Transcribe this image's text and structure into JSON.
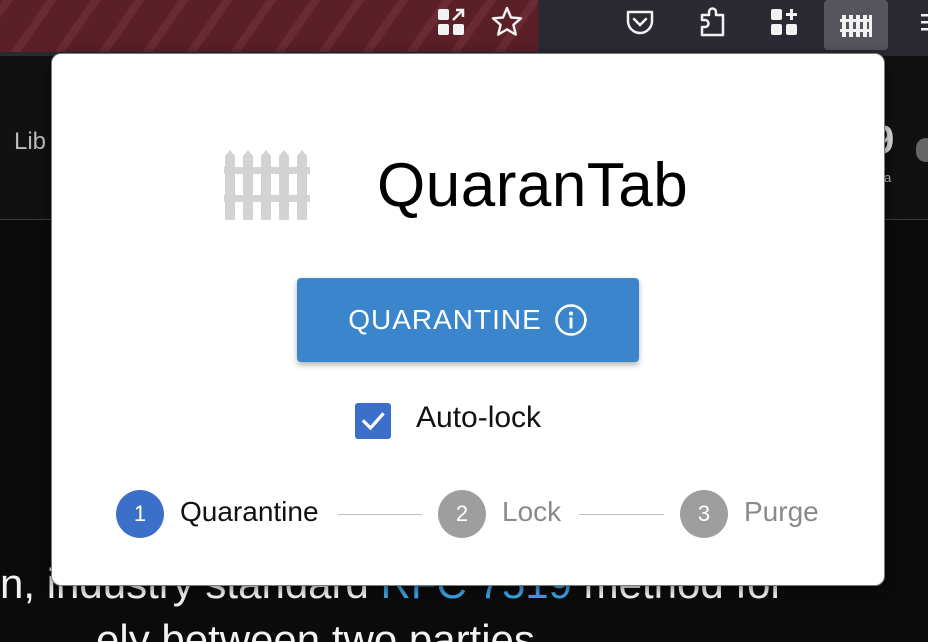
{
  "page": {
    "left_text": "Lib",
    "right_glyph": "9",
    "right_small": "a",
    "bottom_text_before": "n, industry standard ",
    "bottom_link": "RFC 7519",
    "bottom_text_after": " method for",
    "bottom_text2": "ely between two parties."
  },
  "toolbar": {
    "icons": [
      "extensions-grid-icon",
      "bookmark-star-icon",
      "pocket-icon",
      "extensions-puzzle-icon",
      "add-grid-icon",
      "quarantab-fence-icon",
      "menu-icon"
    ]
  },
  "popup": {
    "title": "QuaranTab",
    "quarantine_button_label": "QUARANTINE",
    "autolock_label": "Auto-lock",
    "autolock_checked": true,
    "steps": [
      {
        "number": "1",
        "label": "Quarantine",
        "active": true
      },
      {
        "number": "2",
        "label": "Lock",
        "active": false
      },
      {
        "number": "3",
        "label": "Purge",
        "active": false
      }
    ],
    "colors": {
      "primary": "#3b85cc",
      "checkbox": "#3b6fc9",
      "step_active": "#3b6fc9",
      "step_inactive": "#9e9e9e"
    }
  }
}
